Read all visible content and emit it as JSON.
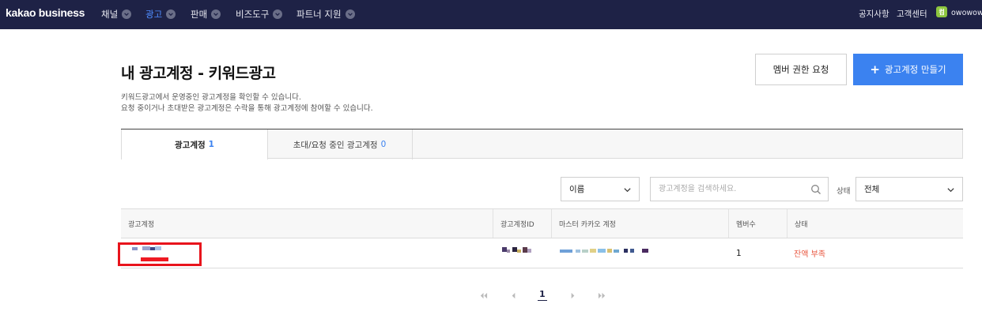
{
  "nav": {
    "logo": "kakao business",
    "items": [
      {
        "label": "채널",
        "active": false
      },
      {
        "label": "광고",
        "active": true
      },
      {
        "label": "판매",
        "active": false
      },
      {
        "label": "비즈도구",
        "active": false
      },
      {
        "label": "파트너 지원",
        "active": false
      }
    ],
    "notice": "공지사항",
    "support": "고객센터",
    "avatar_initial": "컴",
    "username": "owowow"
  },
  "header": {
    "title": "내 광고계정 - 키워드광고",
    "desc_line1": "키워드광고에서 운영중인 광고계정을 확인할 수 있습니다.",
    "desc_line2": "요청 중이거나 초대받은 광고계정은 수락을 통해 광고계정에 참여할 수 있습니다.",
    "member_request_button": "멤버 권한 요청",
    "create_button": "광고계정 만들기"
  },
  "tabs": [
    {
      "label": "광고계정",
      "count": "1",
      "active": true
    },
    {
      "label": "초대/요청 중인 광고계정",
      "count": "0",
      "active": false
    }
  ],
  "filters": {
    "sort_value": "이름",
    "search_placeholder": "광고계정을 검색하세요.",
    "status_label": "상태",
    "status_value": "전체"
  },
  "table": {
    "headers": [
      "광고계정",
      "광고계정ID",
      "마스터 카카오 계정",
      "멤버수",
      "상태"
    ],
    "rows": [
      {
        "account": "",
        "account_id": "",
        "master": "",
        "members": "1",
        "status": "잔액 부족"
      }
    ]
  },
  "pagination": {
    "current": "1"
  },
  "colors": {
    "nav_bg": "#1e2246",
    "accent": "#3b82f0",
    "status_warning": "#e8543c",
    "highlight": "#e8141c"
  }
}
